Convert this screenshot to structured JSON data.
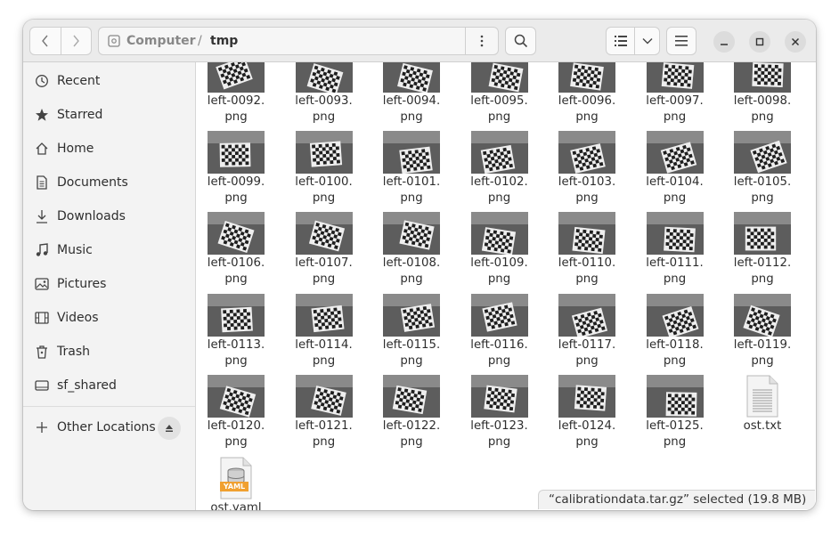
{
  "path": {
    "root_label": "Computer",
    "separator": "/",
    "current": "tmp"
  },
  "sidebar": {
    "items": [
      {
        "label": "Recent",
        "icon": "recent-icon"
      },
      {
        "label": "Starred",
        "icon": "star-icon"
      },
      {
        "label": "Home",
        "icon": "home-icon"
      },
      {
        "label": "Documents",
        "icon": "document-icon"
      },
      {
        "label": "Downloads",
        "icon": "download-icon"
      },
      {
        "label": "Music",
        "icon": "music-icon"
      },
      {
        "label": "Pictures",
        "icon": "picture-icon"
      },
      {
        "label": "Videos",
        "icon": "video-icon"
      },
      {
        "label": "Trash",
        "icon": "trash-icon"
      },
      {
        "label": "sf_shared",
        "icon": "drive-icon"
      }
    ],
    "other_locations": "Other Locations"
  },
  "files": [
    {
      "name": "left-0092.\npng"
    },
    {
      "name": "left-0093.\npng"
    },
    {
      "name": "left-0094.\npng"
    },
    {
      "name": "left-0095.\npng"
    },
    {
      "name": "left-0096.\npng"
    },
    {
      "name": "left-0097.\npng"
    },
    {
      "name": "left-0098.\npng"
    },
    {
      "name": "left-0099.\npng"
    },
    {
      "name": "left-0100.\npng"
    },
    {
      "name": "left-0101.\npng"
    },
    {
      "name": "left-0102.\npng"
    },
    {
      "name": "left-0103.\npng"
    },
    {
      "name": "left-0104.\npng"
    },
    {
      "name": "left-0105.\npng"
    },
    {
      "name": "left-0106.\npng"
    },
    {
      "name": "left-0107.\npng"
    },
    {
      "name": "left-0108.\npng"
    },
    {
      "name": "left-0109.\npng"
    },
    {
      "name": "left-0110.\npng"
    },
    {
      "name": "left-0111.\npng"
    },
    {
      "name": "left-0112.\npng"
    },
    {
      "name": "left-0113.\npng"
    },
    {
      "name": "left-0114.\npng"
    },
    {
      "name": "left-0115.\npng"
    },
    {
      "name": "left-0116.\npng"
    },
    {
      "name": "left-0117.\npng"
    },
    {
      "name": "left-0118.\npng"
    },
    {
      "name": "left-0119.\npng"
    },
    {
      "name": "left-0120.\npng"
    },
    {
      "name": "left-0121.\npng"
    },
    {
      "name": "left-0122.\npng"
    },
    {
      "name": "left-0123.\npng"
    },
    {
      "name": "left-0124.\npng"
    },
    {
      "name": "left-0125.\npng"
    },
    {
      "name": "ost.txt",
      "type": "text"
    },
    {
      "name": "ost.yaml",
      "type": "yaml",
      "badge": "YAML"
    }
  ],
  "status": {
    "text": "“calibrationdata.tar.gz” selected  (19.8 MB)"
  },
  "colors": {
    "accent": "#e95420",
    "yaml_badge": "#f0a030"
  }
}
